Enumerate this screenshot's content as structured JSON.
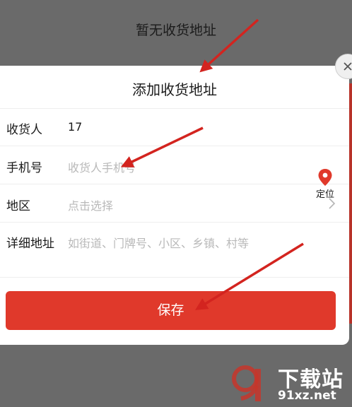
{
  "background": {
    "empty_text": "暂无收货地址"
  },
  "sheet": {
    "title": "添加收货地址",
    "fields": {
      "recipient": {
        "label": "收货人",
        "value": "17"
      },
      "phone": {
        "label": "手机号",
        "placeholder": "收货人手机号"
      },
      "region": {
        "label": "地区",
        "placeholder": "点击选择"
      },
      "address": {
        "label": "详细地址",
        "placeholder": "如街道、门牌号、小区、乡镇、村等"
      }
    },
    "locate_label": "定位",
    "save_label": "保存"
  },
  "watermark": {
    "brand": "下载站",
    "domain": "91xz.net"
  },
  "colors": {
    "accent": "#e0392b",
    "arrow": "#d3241f"
  },
  "icons": {
    "close": "close-icon",
    "chevron": "chevron-right-icon",
    "location": "location-pin-icon"
  }
}
